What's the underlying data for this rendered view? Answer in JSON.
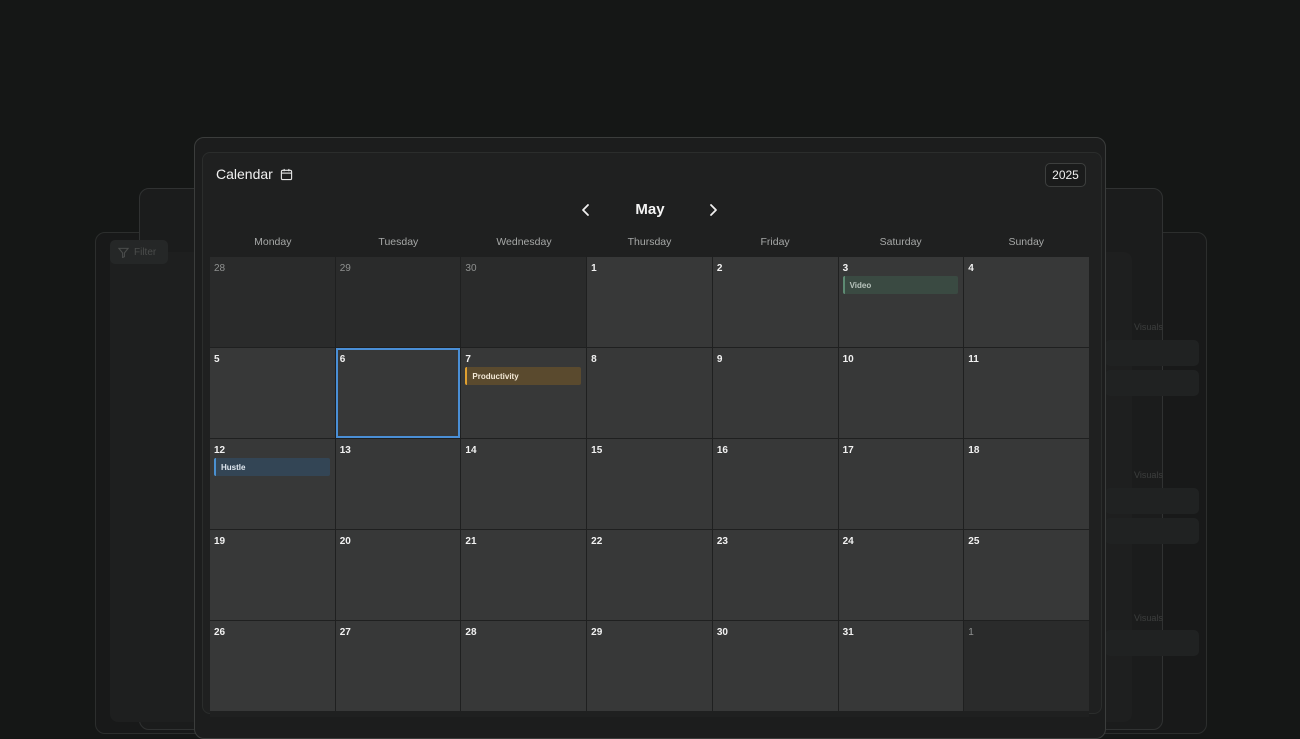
{
  "calendar": {
    "title": "Calendar",
    "year": "2025",
    "month": "May",
    "weekdays": [
      "Monday",
      "Tuesday",
      "Wednesday",
      "Thursday",
      "Friday",
      "Saturday",
      "Sunday"
    ],
    "days": [
      {
        "n": "28",
        "other": true
      },
      {
        "n": "29",
        "other": true
      },
      {
        "n": "30",
        "other": true
      },
      {
        "n": "1"
      },
      {
        "n": "2"
      },
      {
        "n": "3",
        "event": {
          "label": "Video",
          "bg": "#3a4a42",
          "border": "#5d8a72",
          "color": "#b8c4bd"
        }
      },
      {
        "n": "4"
      },
      {
        "n": "5"
      },
      {
        "n": "6",
        "selected": true
      },
      {
        "n": "7",
        "event": {
          "label": "Productivity",
          "bg": "#5a4a2e",
          "border": "#e0a030",
          "color": "#f4ead8"
        }
      },
      {
        "n": "8"
      },
      {
        "n": "9"
      },
      {
        "n": "10"
      },
      {
        "n": "11"
      },
      {
        "n": "12",
        "event": {
          "label": "Hustle",
          "bg": "#334555",
          "border": "#4a90d0",
          "color": "#e0e8f0"
        }
      },
      {
        "n": "13"
      },
      {
        "n": "14"
      },
      {
        "n": "15"
      },
      {
        "n": "16"
      },
      {
        "n": "17"
      },
      {
        "n": "18"
      },
      {
        "n": "19"
      },
      {
        "n": "20"
      },
      {
        "n": "21"
      },
      {
        "n": "22"
      },
      {
        "n": "23"
      },
      {
        "n": "24"
      },
      {
        "n": "25"
      },
      {
        "n": "26"
      },
      {
        "n": "27"
      },
      {
        "n": "28"
      },
      {
        "n": "29"
      },
      {
        "n": "30"
      },
      {
        "n": "31"
      },
      {
        "n": "1",
        "other": true
      }
    ],
    "colors": {
      "selected_border": "#4a8fd6",
      "cell": "#373838",
      "cell_other": "#2a2b2b"
    }
  },
  "background": {
    "filter_label": "Filter",
    "visuals_label": "Visuals"
  }
}
